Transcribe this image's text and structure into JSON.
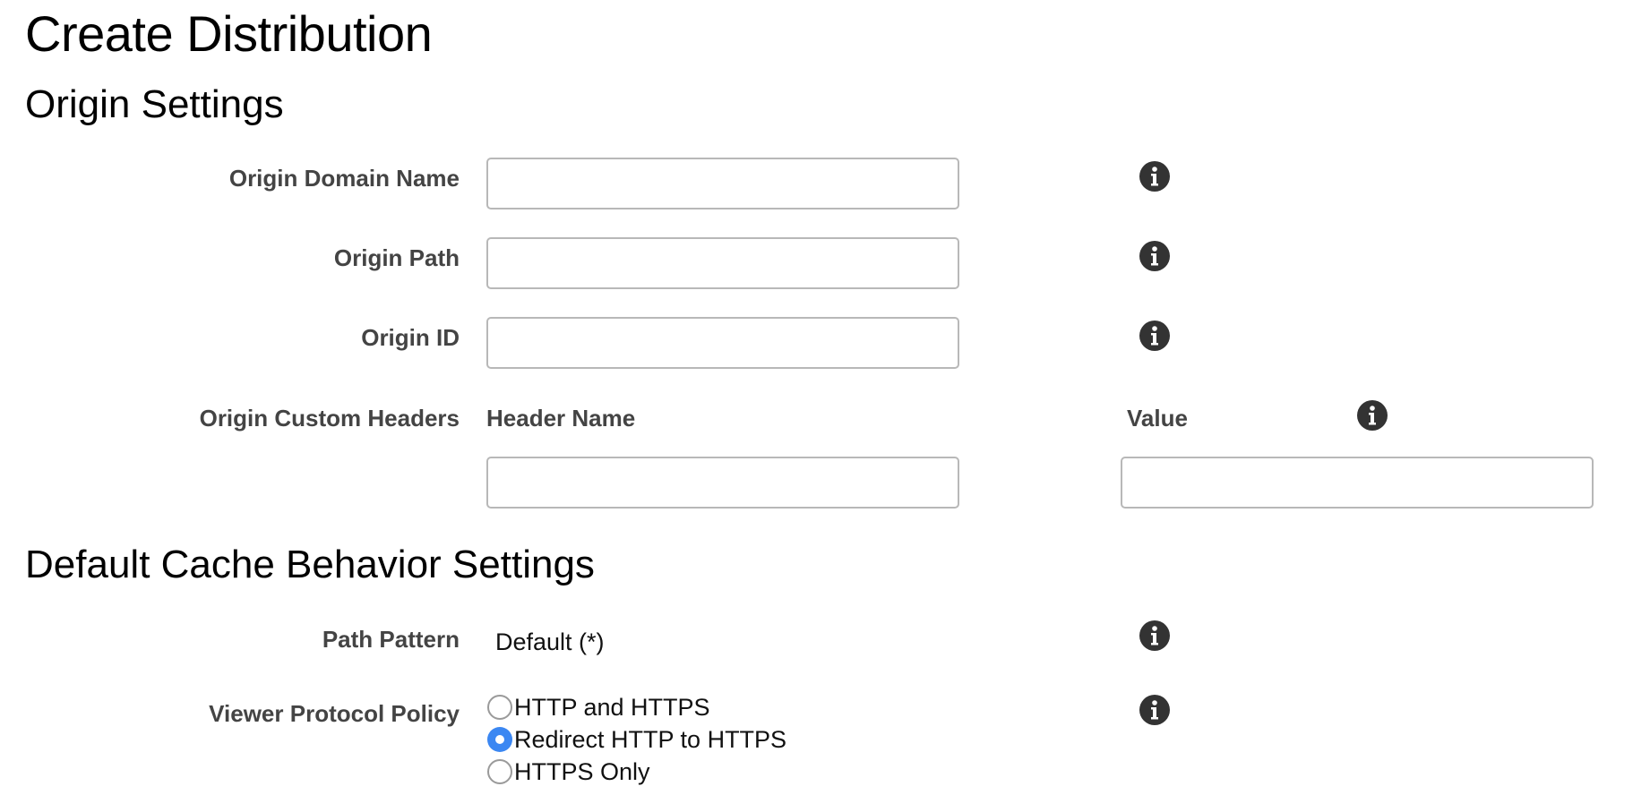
{
  "page": {
    "title": "Create Distribution"
  },
  "origin_settings": {
    "heading": "Origin Settings",
    "domain_name": {
      "label": "Origin Domain Name",
      "value": "",
      "placeholder": ""
    },
    "path": {
      "label": "Origin Path",
      "value": "",
      "placeholder": ""
    },
    "origin_id": {
      "label": "Origin ID",
      "value": "",
      "placeholder": ""
    },
    "custom_headers": {
      "label": "Origin Custom Headers",
      "header_name_label": "Header Name",
      "value_label": "Value",
      "header_name_value": "",
      "value_value": ""
    }
  },
  "cache_behavior": {
    "heading": "Default Cache Behavior Settings",
    "path_pattern": {
      "label": "Path Pattern",
      "value": "Default (*)"
    },
    "viewer_protocol_policy": {
      "label": "Viewer Protocol Policy",
      "options": [
        {
          "label": "HTTP and HTTPS",
          "selected": false
        },
        {
          "label": "Redirect HTTP to HTTPS",
          "selected": true
        },
        {
          "label": "HTTPS Only",
          "selected": false
        }
      ]
    }
  },
  "icons": {
    "help": "info-icon"
  },
  "colors": {
    "radio_selected": "#3b87f2",
    "info_icon_bg": "#333333",
    "label_text": "#444444",
    "input_border": "#b8b8b8"
  }
}
